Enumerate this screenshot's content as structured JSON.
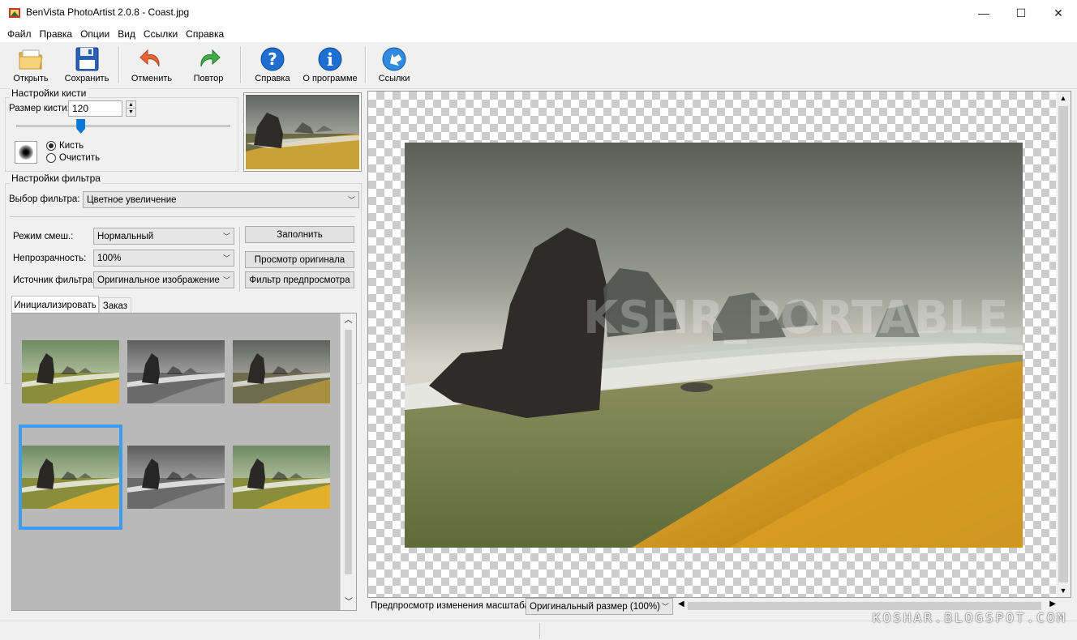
{
  "window": {
    "title": "BenVista PhotoArtist 2.0.8 - Coast.jpg",
    "minimize": "—",
    "maximize": "☐",
    "close": "✕"
  },
  "menu": [
    "Файл",
    "Правка",
    "Опции",
    "Вид",
    "Ссылки",
    "Справка"
  ],
  "toolbar": {
    "open": "Открыть",
    "save": "Сохранить",
    "undo": "Отменить",
    "redo": "Повтор",
    "help": "Справка",
    "about": "О программе",
    "links": "Ссылки"
  },
  "brush": {
    "group_title": "Настройки кисти",
    "size_label": "Размер кисти:",
    "size_value": "120",
    "size_slider_fraction": 0.3,
    "radio_brush": "Кисть",
    "radio_clear": "Очистить",
    "selected": "brush"
  },
  "filter": {
    "group_title": "Настройки фильтра",
    "select_label": "Выбор фильтра:",
    "select_value": "Цветное увеличение",
    "blend_label": "Режим смеш.:",
    "blend_value": "Нормальный",
    "opacity_label": "Непрозрачность:",
    "opacity_value": "100%",
    "source_label": "Источник фильтра:",
    "source_value": "Оригинальное изображение",
    "fill_button": "Заполнить",
    "view_original_button": "Просмотр оригинала",
    "preview_filter_button": "Фильтр предпросмотра"
  },
  "tabs": {
    "init": "Инициализировать",
    "order": "Заказ",
    "active": "init"
  },
  "presets": [
    {
      "style": "color"
    },
    {
      "style": "gray"
    },
    {
      "style": "muted"
    },
    {
      "style": "color",
      "selected": true
    },
    {
      "style": "gray"
    },
    {
      "style": "color"
    }
  ],
  "watermark": "KSHR_PORTABLE",
  "zoom": {
    "label": "Предпросмотр изменения масштаба:",
    "value": "Оригинальный размер (100%)"
  },
  "footer_watermark": "KOSHAR.BLOGSPOT.COM",
  "colors": {
    "selection": "#3d9bf0",
    "thumb_panel": "#b9b9b9",
    "toolbar_help_blue": "#1e6fd1"
  }
}
